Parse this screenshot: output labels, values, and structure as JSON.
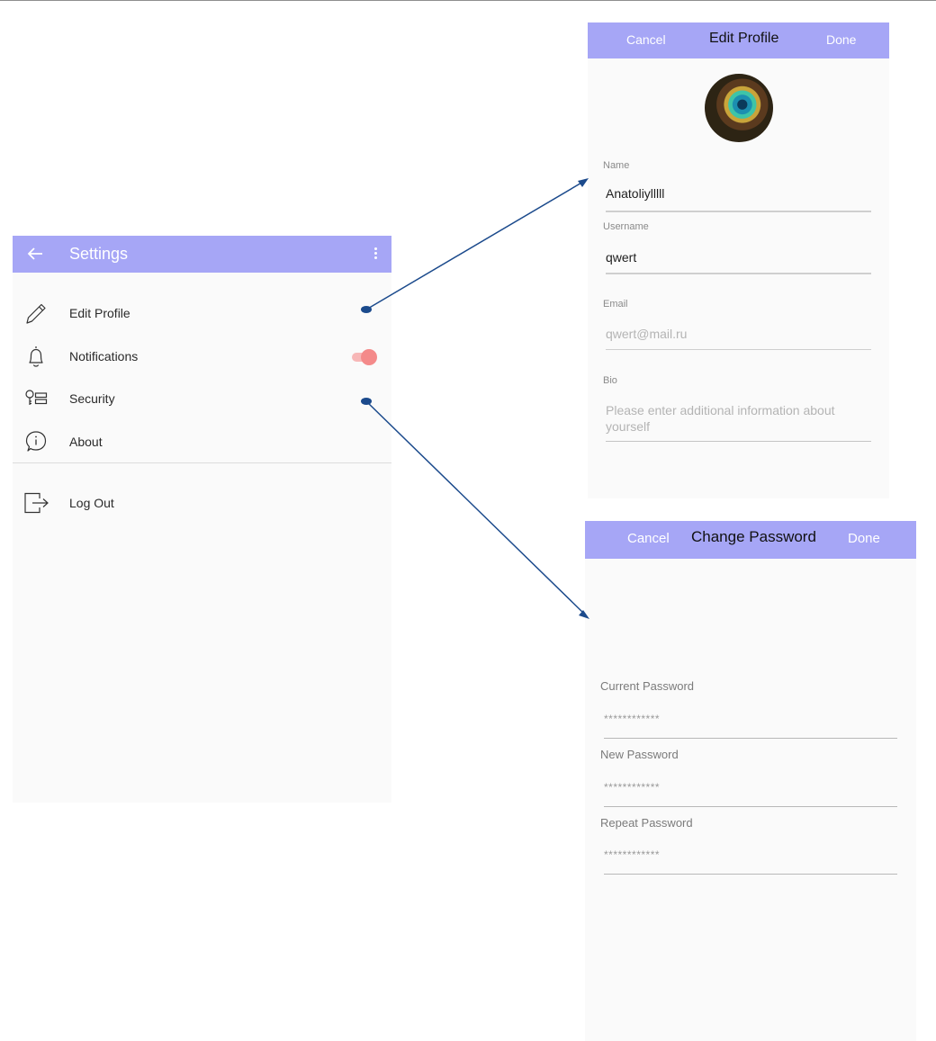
{
  "settings": {
    "title": "Settings",
    "items": [
      {
        "label": "Edit Profile",
        "icon": "pencil-icon"
      },
      {
        "label": "Notifications",
        "icon": "bell-icon",
        "toggle_on": true
      },
      {
        "label": "Security",
        "icon": "key-icon"
      },
      {
        "label": "About",
        "icon": "info-icon"
      },
      {
        "label": "Log Out",
        "icon": "logout-icon"
      }
    ]
  },
  "edit_profile": {
    "cancel": "Cancel",
    "title": "Edit Profile",
    "done": "Done",
    "fields": {
      "name_label": "Name",
      "name_value": "Anatoliylllll",
      "username_label": "Username",
      "username_value": "qwert",
      "email_label": "Email",
      "email_placeholder": "qwert@mail.ru",
      "bio_label": "Bio",
      "bio_placeholder": "Please enter additional information about yourself"
    }
  },
  "change_password": {
    "cancel": "Cancel",
    "title": "Change Password",
    "done": "Done",
    "current_label": "Current Password",
    "current_value": "************",
    "new_label": "New Password",
    "new_value": "************",
    "repeat_label": "Repeat Password",
    "repeat_value": "************"
  },
  "colors": {
    "appbar": "#a6a6f6",
    "toggle_thumb": "#f48a8a",
    "connector": "#1b4a8c"
  }
}
